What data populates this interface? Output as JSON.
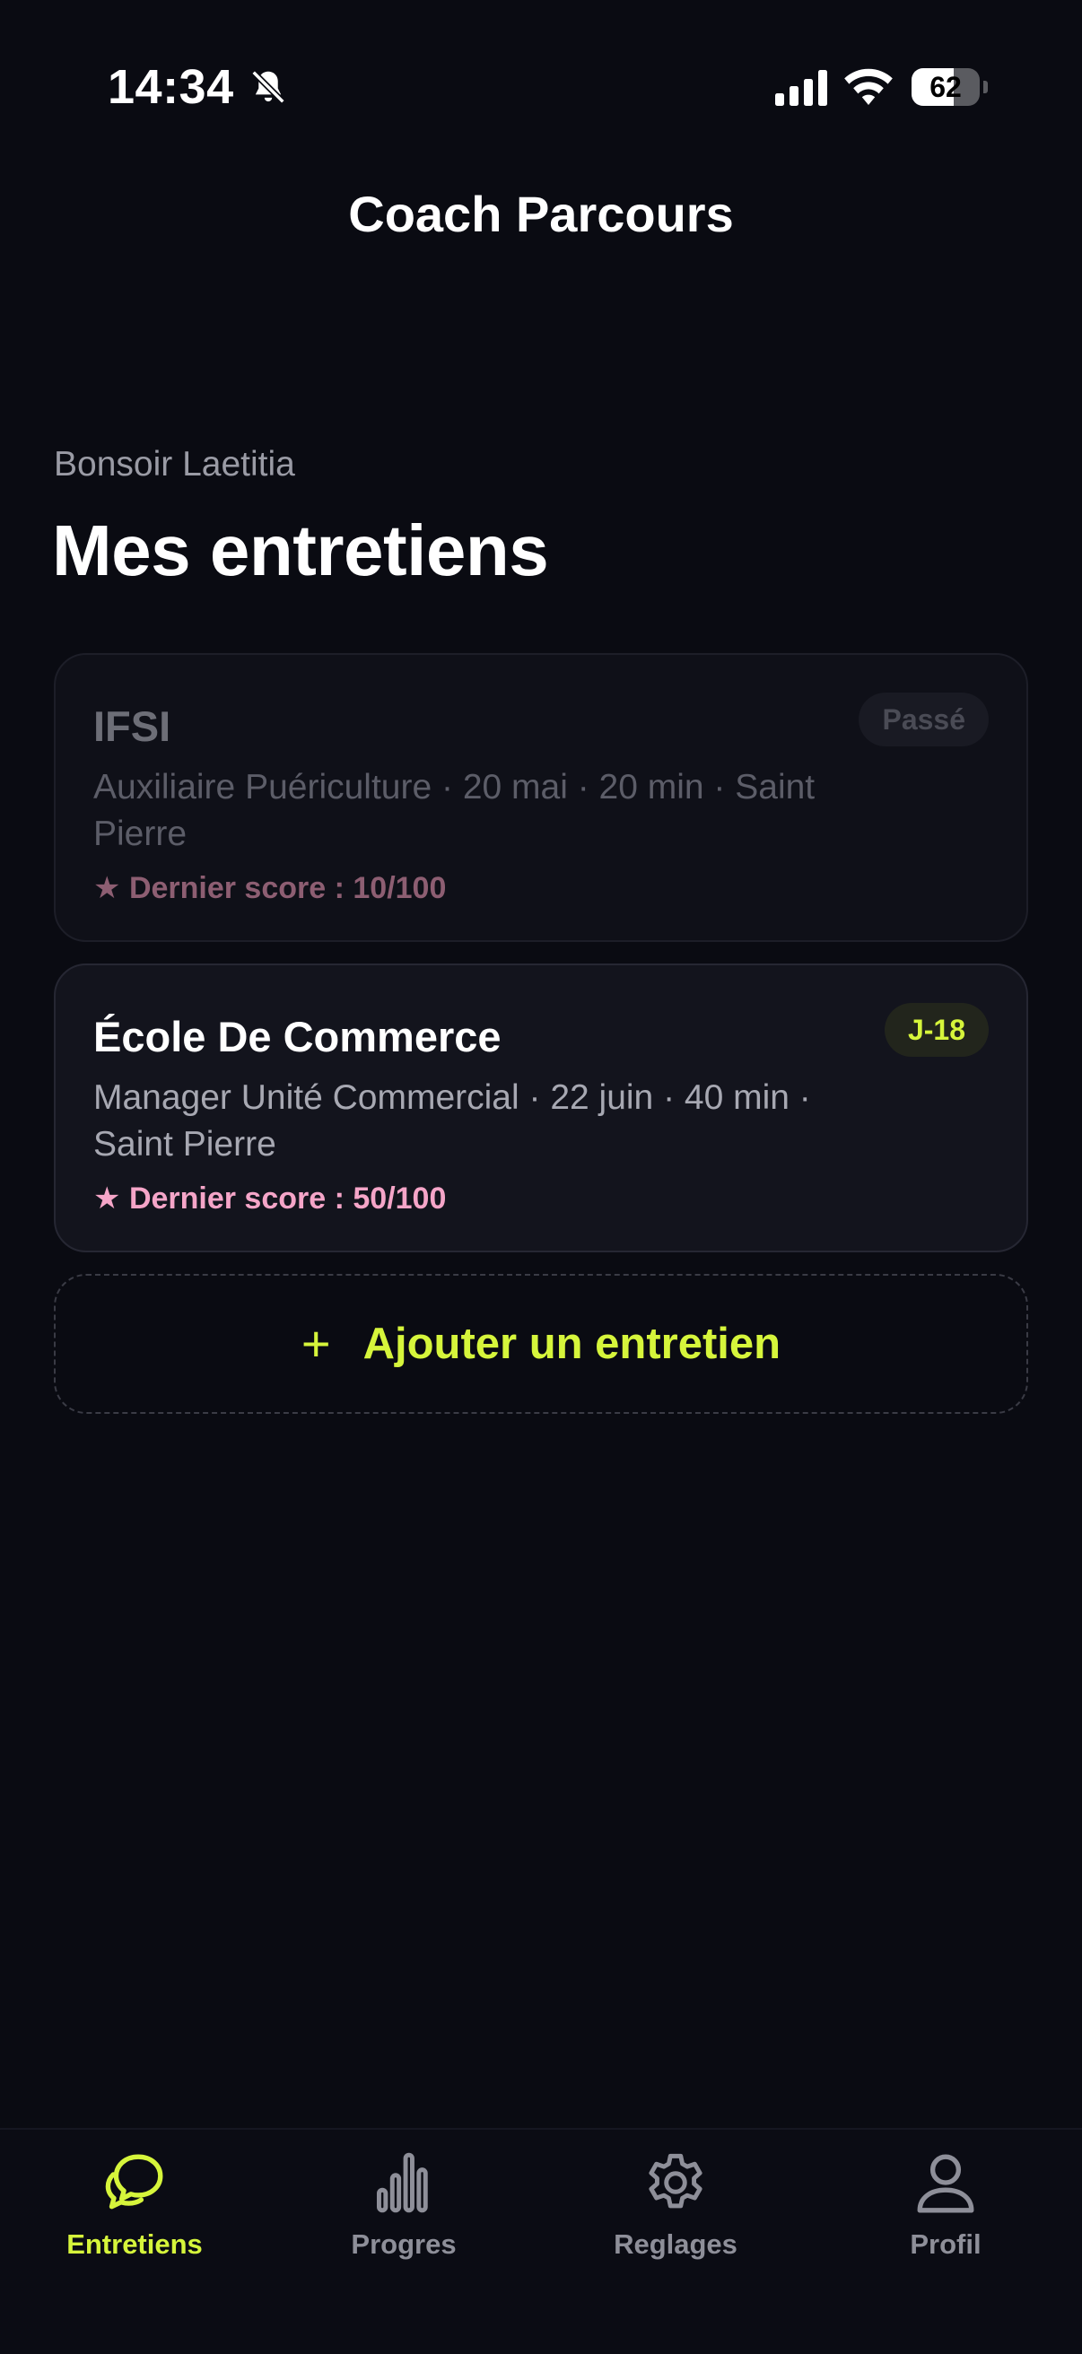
{
  "status_bar": {
    "time": "14:34",
    "battery_level": "62",
    "battery_fraction": 0.62
  },
  "header": {
    "title": "Coach Parcours"
  },
  "main": {
    "greeting": "Bonsoir Laetitia",
    "title": "Mes entretiens",
    "interviews": [
      {
        "title": "IFSI",
        "details": "Auxiliaire Puériculture · 20 mai · 20 min · Saint  Pierre",
        "score": "Dernier score : 10/100",
        "badge": "Passé",
        "state": "past"
      },
      {
        "title": "École De Commerce",
        "details": "Manager Unité Commercial · 22 juin · 40 min · Saint Pierre",
        "score": "Dernier score : 50/100",
        "badge": "J-18",
        "state": "upcoming"
      }
    ],
    "add_button": {
      "icon": "+",
      "label": "Ajouter un entretien"
    }
  },
  "bottom_nav": {
    "items": [
      {
        "label": "Entretiens",
        "icon": "chat-bubbles-icon",
        "active": true
      },
      {
        "label": "Progres",
        "icon": "bar-chart-icon",
        "active": false
      },
      {
        "label": "Reglages",
        "icon": "gear-icon",
        "active": false
      },
      {
        "label": "Profil",
        "icon": "user-icon",
        "active": false
      }
    ]
  },
  "colors": {
    "background": "#0a0b12",
    "accent": "#d6f53b",
    "score_pink": "#f5a5c8",
    "muted_text": "#9a9ba5"
  },
  "star_glyph": "★"
}
